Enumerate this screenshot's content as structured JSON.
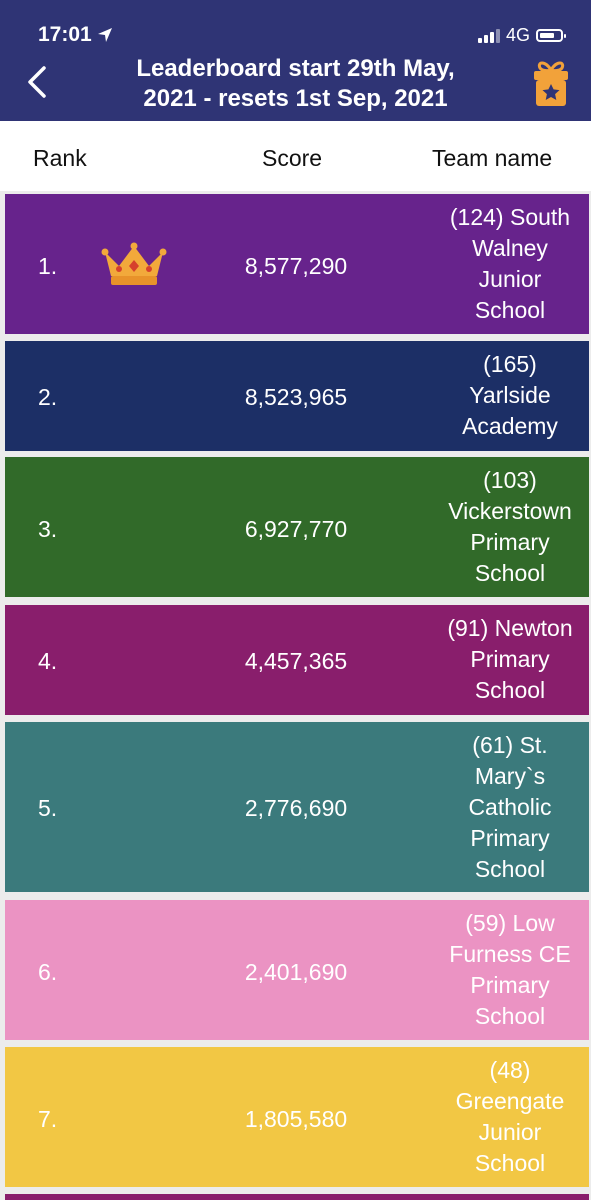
{
  "status_bar": {
    "time": "17:01",
    "network": "4G",
    "icons": [
      "location-arrow-icon",
      "signal-icon",
      "battery-icon"
    ]
  },
  "nav": {
    "back_icon": "chevron-left-icon",
    "title": "Leaderboard start 29th May, 2021 - resets 1st Sep, 2021",
    "title_line1": "Leaderboard start 29th May,",
    "title_line2": "2021 - resets 1st Sep, 2021",
    "action_icon": "gift-star-icon",
    "bar_color": "#2f3475"
  },
  "columns": {
    "rank": "Rank",
    "score": "Score",
    "team": "Team name"
  },
  "rows": [
    {
      "rank": "1.",
      "score": "8,577,290",
      "team_lines": [
        "(124) South",
        "Walney",
        "Junior",
        "School"
      ],
      "color": "#67238c",
      "crown": true
    },
    {
      "rank": "2.",
      "score": "8,523,965",
      "team_lines": [
        "(165)",
        "Yarlside",
        "Academy"
      ],
      "color": "#1c2f66"
    },
    {
      "rank": "3.",
      "score": "6,927,770",
      "team_lines": [
        "(103)",
        "Vickerstown",
        "Primary",
        "School"
      ],
      "color": "#316a29"
    },
    {
      "rank": "4.",
      "score": "4,457,365",
      "team_lines": [
        "(91) Newton",
        "Primary",
        "School"
      ],
      "color": "#891e6c"
    },
    {
      "rank": "5.",
      "score": "2,776,690",
      "team_lines": [
        "(61) St.",
        "Mary`s",
        "Catholic",
        "Primary",
        "School"
      ],
      "color": "#3b7a7c"
    },
    {
      "rank": "6.",
      "score": "2,401,690",
      "team_lines": [
        "(59) Low",
        "Furness CE",
        "Primary",
        "School"
      ],
      "color": "#eb93c3"
    },
    {
      "rank": "7.",
      "score": "1,805,580",
      "team_lines": [
        "(48)",
        "Greengate",
        "Junior",
        "School"
      ],
      "color": "#f2c744"
    }
  ],
  "leader_icon": "crown-icon"
}
